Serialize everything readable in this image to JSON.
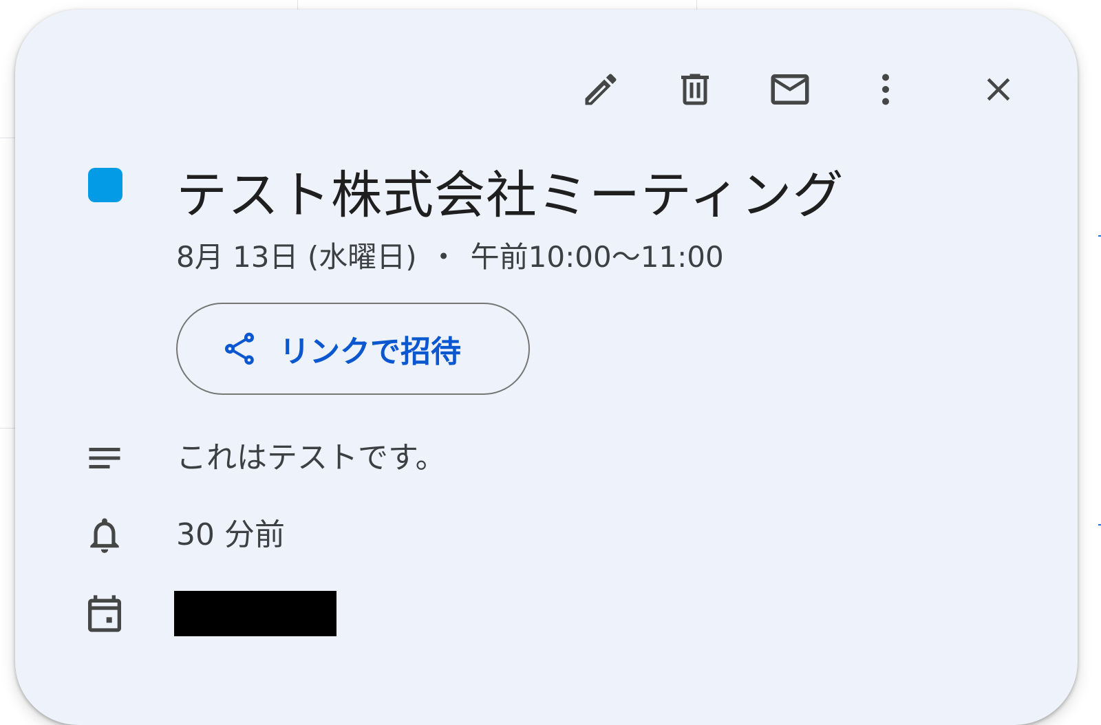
{
  "toolbar": {
    "edit": "edit-icon",
    "delete": "delete-icon",
    "email": "email-icon",
    "more": "more-vert-icon",
    "close": "close-icon"
  },
  "event": {
    "color": "#039be5",
    "title": "テスト株式会社ミーティング",
    "date": "8月 13日 (水曜日)",
    "separator": "・",
    "time": "午前10:00～11:00"
  },
  "invite": {
    "icon": "share-icon",
    "label": "リンクで招待"
  },
  "details": {
    "description_icon": "description-lines-icon",
    "description": "これはテストです。",
    "reminder_icon": "bell-icon",
    "reminder": "30 分前",
    "calendar_icon": "calendar-icon"
  },
  "colors": {
    "card_bg": "#eef2fa",
    "icon": "#444746",
    "accent": "#0b57d0"
  }
}
